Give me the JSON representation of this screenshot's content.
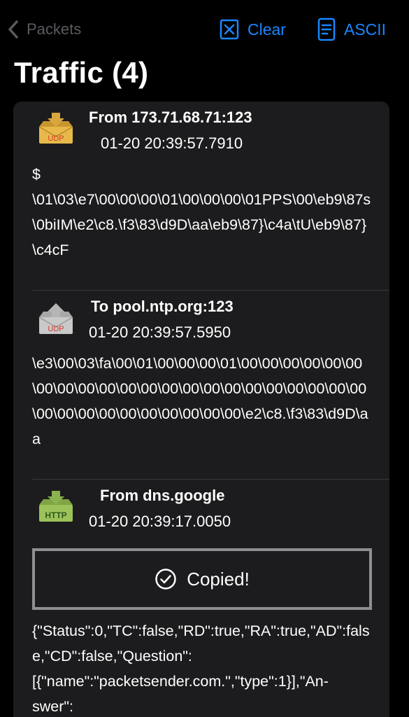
{
  "nav": {
    "back_label": "Packets",
    "clear_label": "Clear",
    "ascii_label": "ASCII"
  },
  "title": "Traffic (4)",
  "packets": [
    {
      "icon_text": "UDP",
      "icon": "udp-download-icon",
      "header": "From 173.71.68.71:123",
      "time": "01-20 20:39:57.7910",
      "body": "$\n\\01\\03\\e7\\00\\00\\00\\01\\00\\00\\00\\01PPS\\00\\eb9\\87s\\0biIM\\e2\\c8.\\f3\\83\\d9D\\aa\\eb9\\87}\\c4a\\tU\\eb9\\87}\\c4cF"
    },
    {
      "icon_text": "UDP",
      "icon": "udp-upload-icon",
      "header": "To pool.ntp.org:123",
      "time": "01-20 20:39:57.5950",
      "body": "\\e3\\00\\03\\fa\\00\\01\\00\\00\\00\\01\\00\\00\\00\\00\\00\\00\\00\\00\\00\\00\\00\\00\\00\\00\\00\\00\\00\\00\\00\\00\\00\\00\\00\\00\\00\\00\\00\\00\\00\\00\\00\\00\\e2\\c8.\\f3\\83\\d9D\\aa"
    },
    {
      "icon_text": "HTTP",
      "icon": "http-download-icon",
      "header": "From dns.google",
      "time": "01-20 20:39:17.0050",
      "body": "{\"Status\":0,\"TC\":false,\"RD\":true,\"RA\":true,\"AD\":false,\"CD\":false,\"Question\":\n[{\"name\":\"packetsender.com.\",\"type\":1}],\"An-\nswer\":"
    }
  ],
  "toast": {
    "label": "Copied!"
  },
  "colors": {
    "accent": "#1b86ff",
    "card": "#1c1c1e",
    "udp_in": "#e8b94a",
    "udp_out": "#c9c9c9",
    "http_in": "#9cc25a"
  }
}
